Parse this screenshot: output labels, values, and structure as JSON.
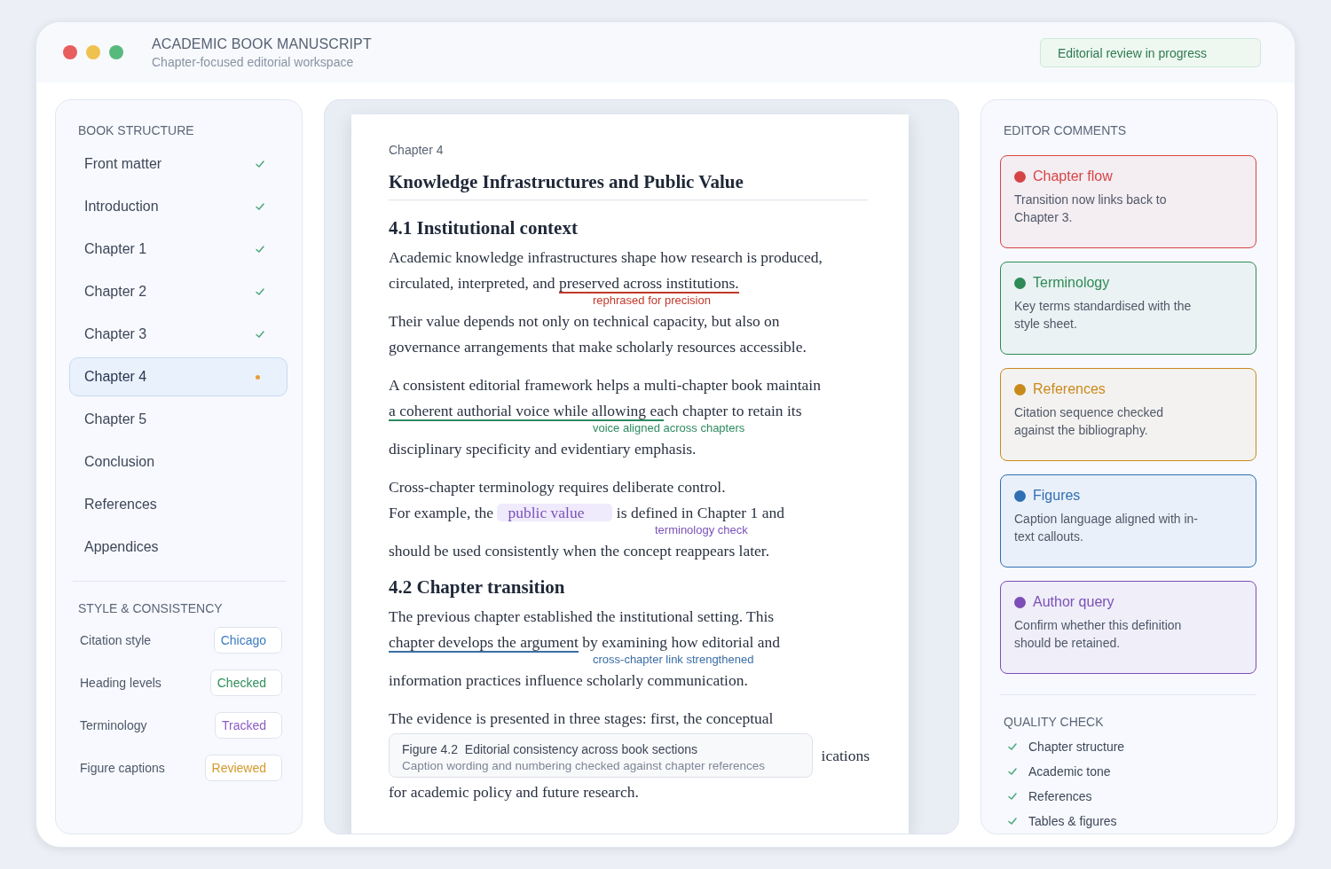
{
  "window": {
    "title": "ACADEMIC BOOK MANUSCRIPT",
    "subtitle": "Chapter-focused editorial workspace",
    "status_badge": "Editorial review in progress"
  },
  "book_structure": {
    "heading": "BOOK STRUCTURE",
    "items": [
      {
        "label": "Front matter",
        "kind": "done",
        "selected": false
      },
      {
        "label": "Introduction",
        "kind": "done",
        "selected": false
      },
      {
        "label": "Chapter 1",
        "kind": "done",
        "selected": false
      },
      {
        "label": "Chapter 2",
        "kind": "done",
        "selected": false
      },
      {
        "label": "Chapter 3",
        "kind": "done",
        "selected": false
      },
      {
        "label": "Chapter 4",
        "kind": "current",
        "selected": true
      },
      {
        "label": "Chapter 5",
        "kind": "pending",
        "selected": false
      },
      {
        "label": "Conclusion",
        "kind": "pending",
        "selected": false
      },
      {
        "label": "References",
        "kind": "pending",
        "selected": false
      },
      {
        "label": "Appendices",
        "kind": "pending",
        "selected": false
      }
    ]
  },
  "style_consistency": {
    "heading": "STYLE & CONSISTENCY",
    "rows": [
      {
        "label": "Citation style",
        "value": "Chicago",
        "color": "#3b7bbf"
      },
      {
        "label": "Heading levels",
        "value": "Checked",
        "color": "#2f8f5b"
      },
      {
        "label": "Terminology",
        "value": "Tracked",
        "color": "#8a5cc2"
      },
      {
        "label": "Figure captions",
        "value": "Reviewed",
        "color": "#d39a2a"
      }
    ]
  },
  "manuscript": {
    "chapter_label": "Chapter 4",
    "title": "Knowledge Infrastructures and Public Value",
    "blocks": [
      {
        "kind": "heading",
        "text": "4.1 Institutional context"
      },
      {
        "kind": "paragraph",
        "lines": [
          {
            "text": "Academic knowledge infrastructures shape how research is produced,"
          },
          {
            "before": "circulated, interpreted, and ",
            "mark": {
              "kind": "underline",
              "text": "preserved across institutions.",
              "color": "#c0392b",
              "note": "rephrased for precision"
            }
          },
          {
            "text": "Their value depends not only on technical capacity, but also on"
          },
          {
            "text": "governance arrangements that make scholarly resources accessible."
          }
        ]
      },
      {
        "kind": "paragraph",
        "lines": [
          {
            "text": "A consistent editorial framework helps a multi-chapter book maintain"
          },
          {
            "mark": {
              "kind": "underline",
              "text": "a coherent authorial voice while allowing ea",
              "color": "#2e8b62",
              "note": "voice aligned across chapters"
            },
            "after": "ch chapter to retain its"
          },
          {
            "text": "disciplinary specificity and evidentiary emphasis."
          }
        ]
      },
      {
        "kind": "paragraph",
        "lines": [
          {
            "text": "Cross-chapter terminology requires deliberate control."
          },
          {
            "before": "For example, the ",
            "mark": {
              "kind": "highlight",
              "text": "public value",
              "color": "#7b52b8",
              "note": "terminology check"
            },
            "after": " is defined in Chapter 1 and"
          },
          {
            "text": "should be used consistently when the concept reappears later."
          }
        ]
      },
      {
        "kind": "heading",
        "text": "4.2 Chapter transition"
      },
      {
        "kind": "paragraph",
        "lines": [
          {
            "text": "The previous chapter established the institutional setting. This"
          },
          {
            "mark": {
              "kind": "underline",
              "text": "chapter develops the argument",
              "color": "#3a6ea5",
              "note": "cross-chapter link strengthened"
            },
            "after": " by examining how editorial and"
          },
          {
            "text": "information practices influence scholarly communication."
          }
        ]
      },
      {
        "kind": "paragraph",
        "lines": [
          {
            "text": "The evidence is presented in three stages: first, the conceptual"
          },
          {
            "caption": {
              "label": "Figure 4.2",
              "title": "Editorial consistency across book sections",
              "note": "Caption wording and numbering checked against chapter references"
            },
            "text": "ications"
          },
          {
            "text": "for academic policy and future research."
          }
        ]
      }
    ]
  },
  "editor_comments": {
    "heading": "EDITOR COMMENTS",
    "items": [
      {
        "title": "Chapter flow",
        "body": "Transition now links back to Chapter 3.",
        "color": "#d64545"
      },
      {
        "title": "Terminology",
        "body": "Key terms standardised with the style sheet.",
        "color": "#2e8b57"
      },
      {
        "title": "References",
        "body": "Citation sequence checked against the bibliography.",
        "color": "#c98a1b"
      },
      {
        "title": "Figures",
        "body": "Caption language aligned with in-text callouts.",
        "color": "#2f6fb3"
      },
      {
        "title": "Author query",
        "body": "Confirm whether this definition should be retained.",
        "color": "#7b4fb5"
      }
    ]
  },
  "quality_check": {
    "heading": "QUALITY CHECK",
    "items": [
      {
        "label": "Chapter structure",
        "checked": true
      },
      {
        "label": "Academic tone",
        "checked": true
      },
      {
        "label": "References",
        "checked": true
      },
      {
        "label": "Tables & figures",
        "checked": true
      }
    ]
  }
}
